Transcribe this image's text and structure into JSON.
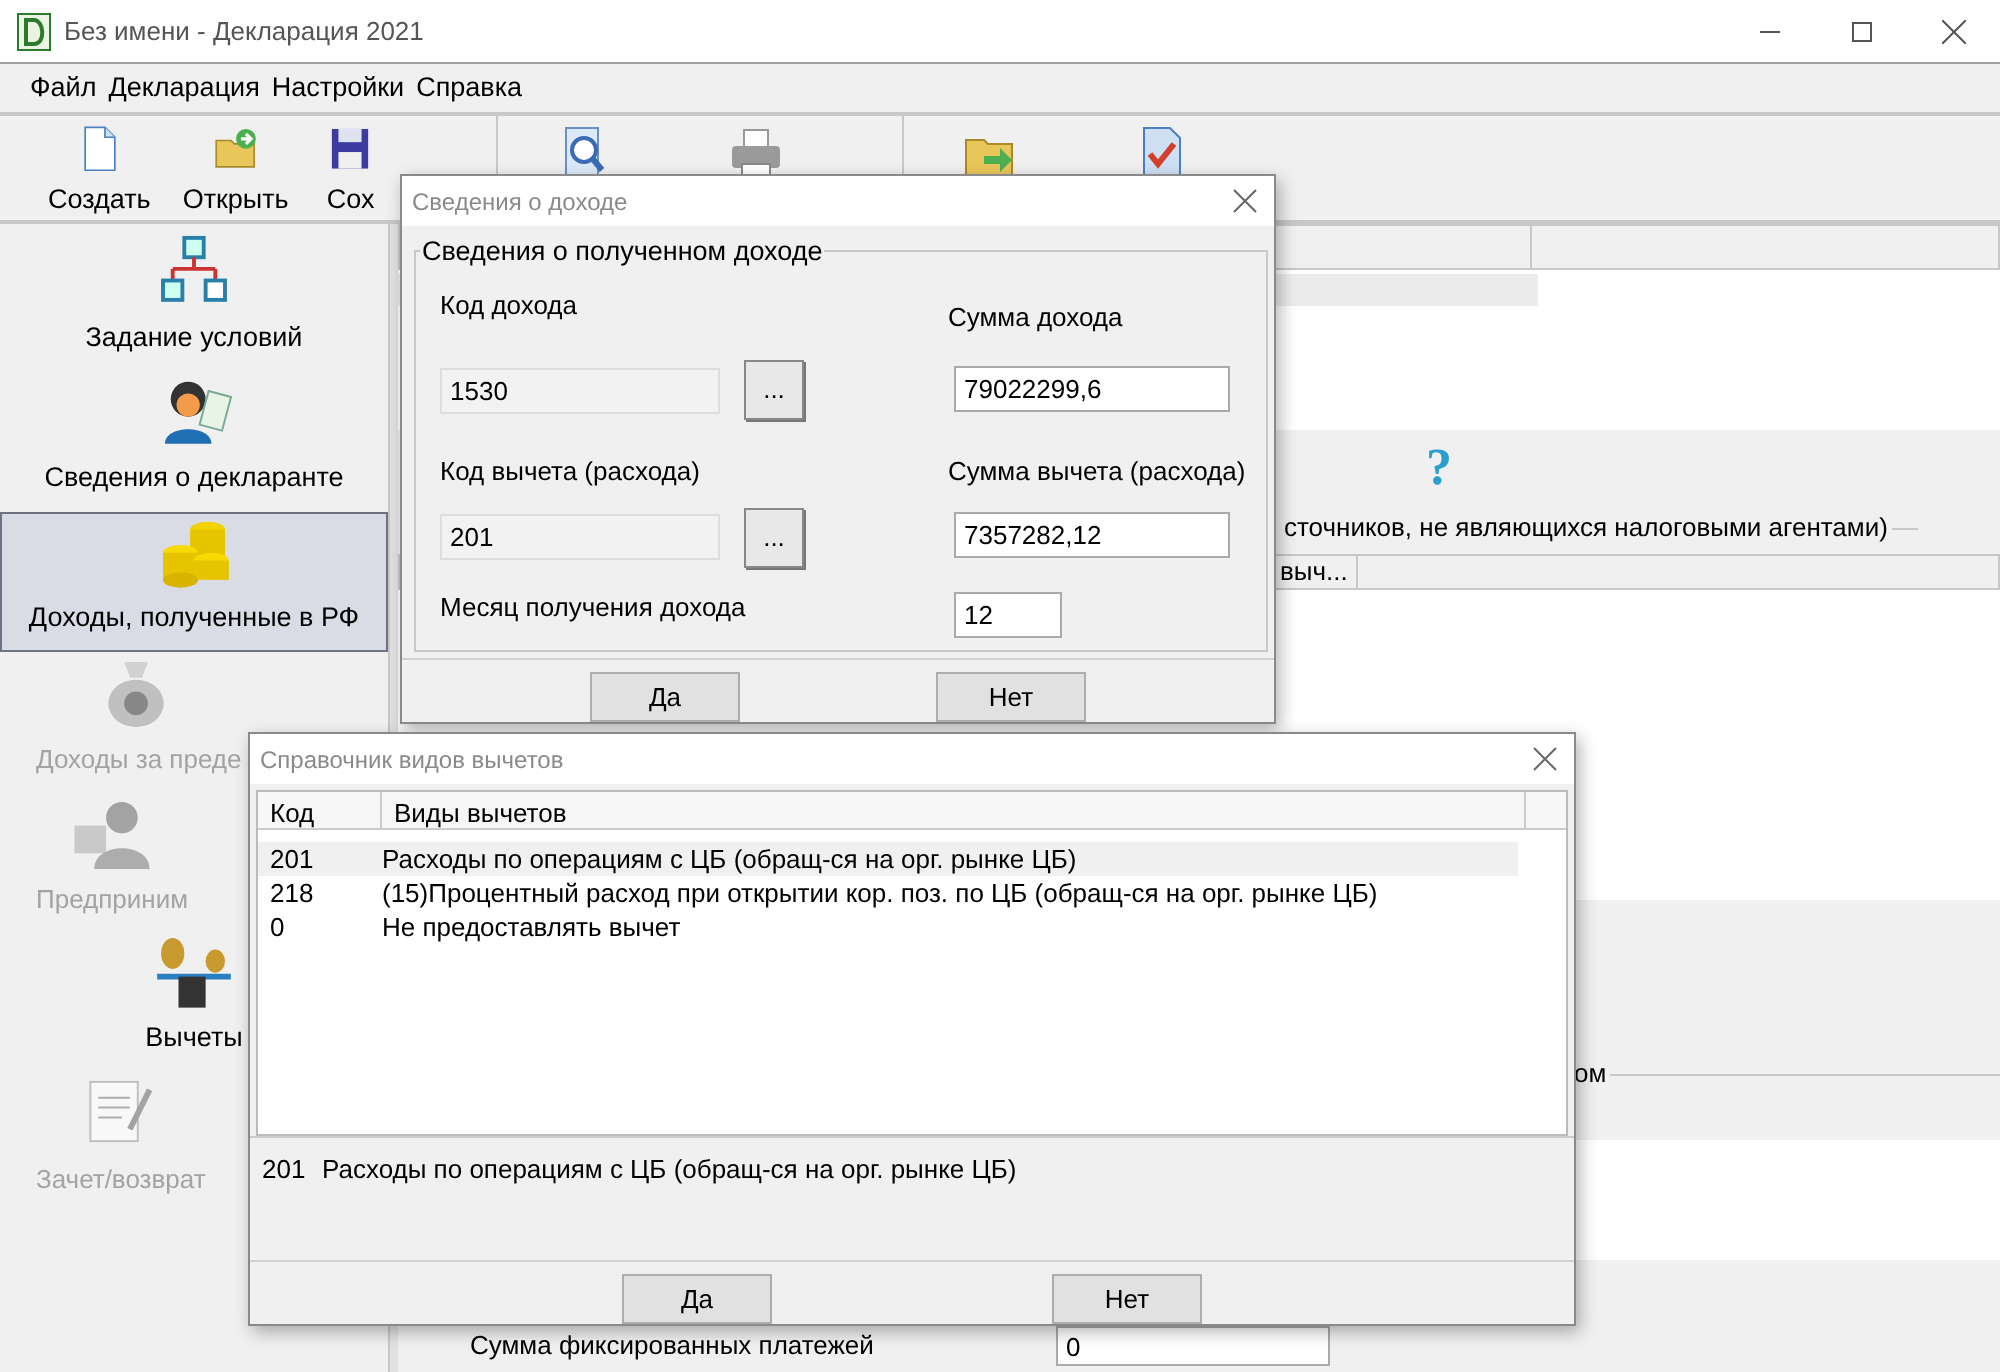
{
  "window": {
    "title": "Без имени - Декларация 2021"
  },
  "menu": [
    "Файл",
    "Декларация",
    "Настройки",
    "Справка"
  ],
  "toolbar": [
    [
      {
        "kind": "new",
        "label": "Создать"
      },
      {
        "kind": "open",
        "label": "Открыть"
      },
      {
        "kind": "save",
        "label": "Сох"
      }
    ],
    [
      {
        "kind": "preview"
      },
      {
        "kind": "print"
      }
    ],
    [
      {
        "kind": "export"
      },
      {
        "kind": "check"
      }
    ]
  ],
  "sidebar": {
    "items": [
      {
        "kind": "conditions",
        "label": "Задание условий",
        "selected": false,
        "disabled": false
      },
      {
        "kind": "person",
        "label": "Сведения о декларанте",
        "selected": false,
        "disabled": false
      },
      {
        "kind": "coins",
        "label": "Доходы, полученные в РФ",
        "selected": true,
        "disabled": false
      },
      {
        "kind": "moneybag",
        "label": "Доходы за преде",
        "selected": false,
        "disabled": true
      },
      {
        "kind": "business",
        "label": "Предприним",
        "selected": false,
        "disabled": true
      },
      {
        "kind": "scales",
        "label": "Вычеты",
        "selected": false,
        "disabled": false
      },
      {
        "kind": "document",
        "label": "Зачет/возврат",
        "selected": false,
        "disabled": true
      }
    ]
  },
  "background": {
    "help": "?",
    "group_title_1": "сточников, не являющихся налоговыми агентами)",
    "column_label": "выч...",
    "group_title_2": "ом",
    "fixed_payments": {
      "label": "Сумма фиксированных платежей",
      "value": "0"
    }
  },
  "income_dialog": {
    "title": "Сведения о доходе",
    "group_title": "Сведения о полученном доходе",
    "income_code": {
      "label": "Код дохода",
      "value": "1530",
      "browse": "..."
    },
    "income_sum": {
      "label": "Сумма дохода",
      "value": "79022299,6"
    },
    "deduction_code": {
      "label": "Код вычета (расхода)",
      "value": "201",
      "browse": "..."
    },
    "deduction_sum": {
      "label": "Сумма вычета (расхода)",
      "value": "7357282,12"
    },
    "month": {
      "label": "Месяц получения дохода",
      "value": "12"
    },
    "buttons": [
      "Да",
      "Нет"
    ]
  },
  "deductions_dialog": {
    "title": "Справочник видов вычетов",
    "columns": [
      "Код",
      "Виды вычетов"
    ],
    "rows": [
      {
        "code": "201",
        "name": "Расходы по операциям с ЦБ (обращ-ся на орг. рынке ЦБ)",
        "selected": true
      },
      {
        "code": "218",
        "name": "(15)Процентный расход при открытии кор. поз. по ЦБ (обращ-ся на орг. рынке ЦБ)",
        "selected": false
      },
      {
        "code": "0",
        "name": "Не предоставлять вычет",
        "selected": false
      }
    ],
    "detail": {
      "code": "201",
      "name": "Расходы по операциям с ЦБ (обращ-ся на орг. рынке ЦБ)"
    },
    "buttons": [
      "Да",
      "Нет"
    ]
  }
}
